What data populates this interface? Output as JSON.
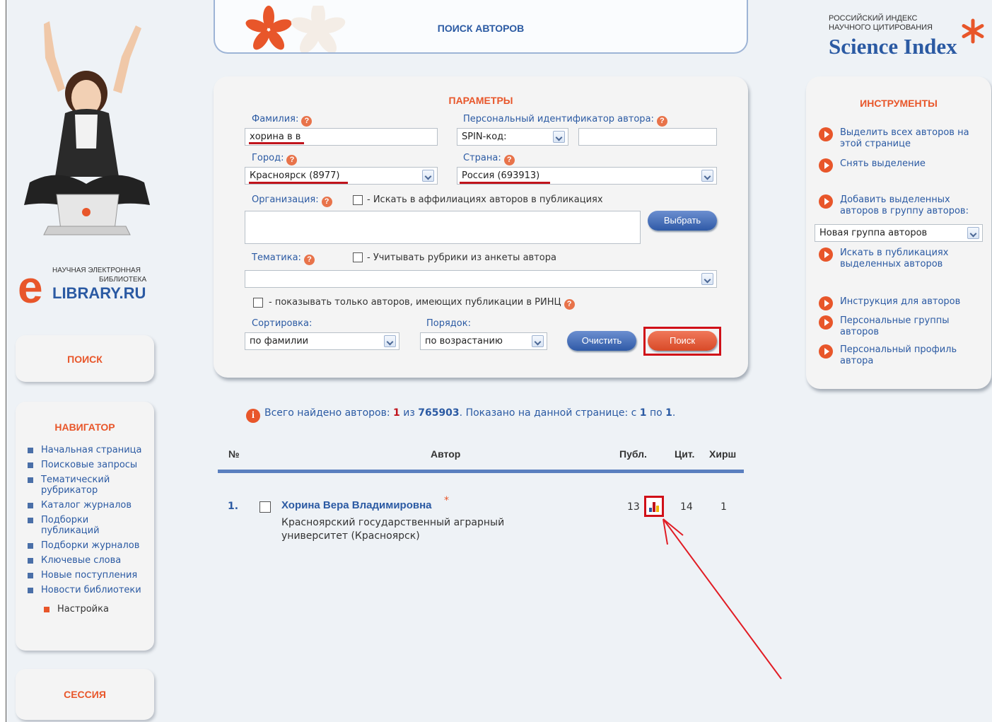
{
  "banner": {
    "title": "ПОИСК АВТОРОВ"
  },
  "elibrary": {
    "line1": "НАУЧНАЯ ЭЛЕКТРОННАЯ",
    "line2": "БИБЛИОТЕКА",
    "name": "LIBRARY.RU"
  },
  "science_index": {
    "line1": "РОССИЙСКИЙ ИНДЕКС",
    "line2": "НАУЧНОГО ЦИТИРОВАНИЯ",
    "name": "Science Index"
  },
  "left_panels": {
    "search": "ПОИСК",
    "navigator": "НАВИГАТОР",
    "session": "СЕССИЯ"
  },
  "navigator_items": [
    "Начальная страница",
    "Поисковые запросы",
    "Тематический рубрикатор",
    "Каталог журналов",
    "Подборки публикаций",
    "Подборки журналов",
    "Ключевые слова",
    "Новые поступления",
    "Новости библиотеки",
    "Настройка"
  ],
  "params": {
    "header": "ПАРАМЕТРЫ",
    "surname_label": "Фамилия:",
    "surname_value": "хорина в в",
    "person_id_label": "Персональный идентификатор автора:",
    "person_id_type": "SPIN-код:",
    "person_id_value": "",
    "city_label": "Город:",
    "city_value": "Красноярск  (8977)",
    "country_label": "Страна:",
    "country_value": "Россия  (693913)",
    "org_label": "Организация:",
    "org_checkbox": "- Искать в аффилиациях авторов в публикациях",
    "org_value": "",
    "choose_button": "Выбрать",
    "topic_label": "Тематика:",
    "topic_checkbox": "- Учитывать рубрики из анкеты автора",
    "topic_value": "",
    "rinc_checkbox": "- показывать только авторов, имеющих публикации в РИНЦ",
    "sort_label": "Сортировка:",
    "sort_value": "по фамилии",
    "order_label": "Порядок:",
    "order_value": "по возрастанию",
    "clear_button": "Очистить",
    "search_button": "Поиск",
    "help_glyph": "?"
  },
  "tools": {
    "header": "ИНСТРУМЕНТЫ",
    "select_all": "Выделить всех авторов на этой странице",
    "deselect": "Снять выделение",
    "add_group": "Добавить выделенных авторов в группу авторов:",
    "group_select": "Новая группа авторов",
    "search_pubs": "Искать в публикациях выделенных авторов",
    "instructions": "Инструкция для авторов",
    "personal_groups": "Персональные группы авторов",
    "personal_profile": "Персональный профиль автора"
  },
  "results": {
    "info_icon": "i",
    "found_prefix": "Всего найдено авторов:",
    "found_count": "1",
    "found_of": "из",
    "found_total": "765903",
    "shown_prefix": ".   Показано на данной странице: с",
    "shown_from": "1",
    "shown_to_word": "по",
    "shown_to": "1",
    "shown_end": ".",
    "col_num": "№",
    "col_author": "Автор",
    "col_pub": "Публ.",
    "col_cit": "Цит.",
    "col_hirsch": "Хирш",
    "rows": [
      {
        "num": "1.",
        "name": "Хорина Вера Владимировна",
        "star": "*",
        "affiliation": "Красноярский государственный аграрный университет (Красноярск)",
        "publications": "13",
        "citations": "14",
        "hirsch": "1"
      }
    ]
  },
  "colors": {
    "accent_orange": "#e8562a",
    "link_blue": "#2b5aa3",
    "highlight_red": "#d01018"
  }
}
